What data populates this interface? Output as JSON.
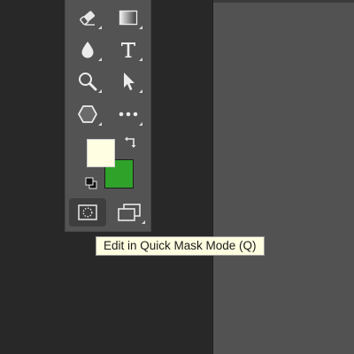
{
  "toolbar": {
    "tools": [
      {
        "name": "eraser",
        "icon": "eraser-icon",
        "has_submenu": true
      },
      {
        "name": "gradient",
        "icon": "gradient-icon",
        "has_submenu": true
      },
      {
        "name": "blur",
        "icon": "blur-drop-icon",
        "has_submenu": true
      },
      {
        "name": "type",
        "icon": "type-icon",
        "has_submenu": true
      },
      {
        "name": "zoom",
        "icon": "zoom-icon",
        "has_submenu": true
      },
      {
        "name": "path-selection",
        "icon": "path-selection-arrow-icon",
        "has_submenu": true
      },
      {
        "name": "shape",
        "icon": "hexagon-shape-icon",
        "has_submenu": true
      },
      {
        "name": "more-tools",
        "icon": "ellipsis-icon",
        "has_submenu": true
      }
    ],
    "colors": {
      "foreground": "#fffde2",
      "background": "#2fa22a"
    },
    "quick_mask_icon": "quick-mask-icon",
    "screen_mode_icon": "screen-mode-icon"
  },
  "tooltip": {
    "text": "Edit in Quick Mask Mode (Q)"
  }
}
